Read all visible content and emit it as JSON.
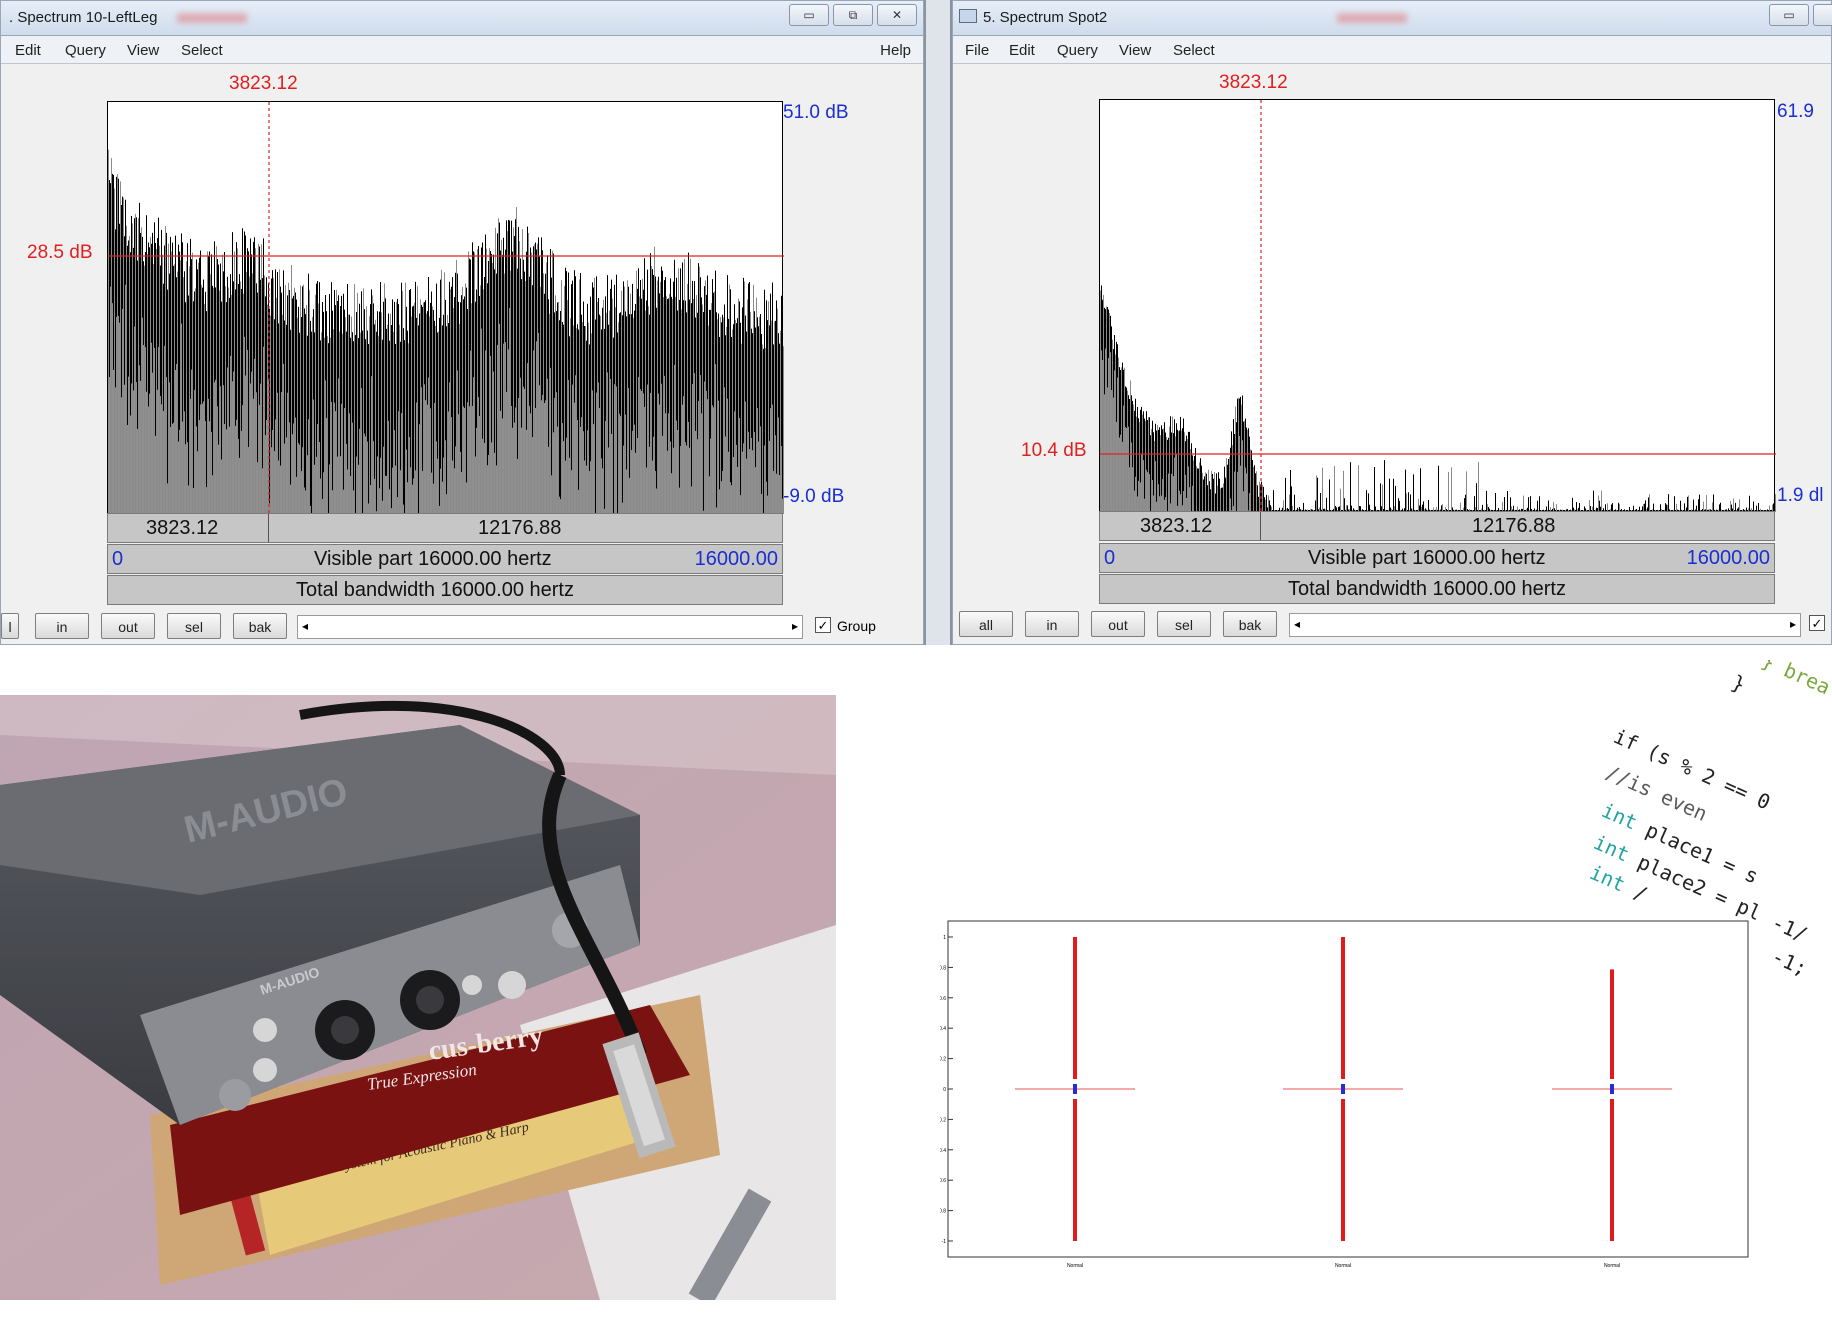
{
  "left_window": {
    "title": ". Spectrum 10-LeftLeg",
    "menu": [
      "Edit",
      "Query",
      "View",
      "Select"
    ],
    "help": "Help",
    "window_buttons": [
      "▭",
      "⧉",
      "✕"
    ],
    "cursor_freq": "3823.12",
    "y_top": "51.0 dB",
    "y_bottom": "-9.0 dB",
    "hline_label": "28.5 dB",
    "bar1_left": "3823.12",
    "bar1_right": "12176.88",
    "visible_left": "0",
    "visible_text": "Visible part 16000.00 hertz",
    "visible_right": "16000.00",
    "total_text": "Total bandwidth 16000.00 hertz",
    "buttons": [
      "l",
      "in",
      "out",
      "sel",
      "bak"
    ],
    "group_label": "Group"
  },
  "right_window": {
    "title": "5. Spectrum Spot2",
    "menu": [
      "File",
      "Edit",
      "Query",
      "View",
      "Select"
    ],
    "window_buttons": [
      "▭",
      "l"
    ],
    "cursor_freq": "3823.12",
    "y_top": "61.9",
    "y_bottom": "1.9 dl",
    "hline_label": "10.4 dB",
    "bar1_left": "3823.12",
    "bar1_right": "12176.88",
    "visible_left": "0",
    "visible_text": "Visible part 16000.00 hertz",
    "visible_right": "16000.00",
    "total_text": "Total bandwidth 16000.00 hertz",
    "buttons": [
      "all",
      "in",
      "out",
      "sel",
      "bak"
    ]
  },
  "photo": {
    "device_brand": "M-AUDIO",
    "device_brand_small": "M-AUDIO",
    "box_brand": "barcus-berry",
    "box_tagline": "Planar Wave System for Acoustic Piano & Harp",
    "box_brand_2": "cus-berry",
    "box_tagline_2": "True Expression"
  },
  "scatter": {
    "y_ticks": [
      "1",
      "0.8",
      "0.6",
      "0.4",
      "0.2",
      "0",
      "-0.2",
      "-0.4",
      "-0.6",
      "-0.8",
      "-1"
    ],
    "x_labels": [
      "Normal",
      "Normal",
      "Normal"
    ]
  },
  "code_fragment": {
    "lines": [
      "} brea",
      "}",
      "if (s % 2 == 0",
      "//is even",
      "int place1 = s",
      "int place2 = pl",
      "int /",
      "-1/",
      "-1;"
    ]
  },
  "colors": {
    "cursor_red": "#e02020",
    "axis_blue": "#1a2fd0",
    "scatter_red": "#e11b1b",
    "scatter_blue": "#2a2ad8"
  }
}
